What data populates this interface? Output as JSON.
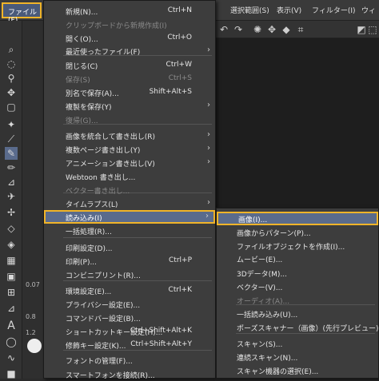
{
  "menubar": {
    "file_label": "ファイル(F)",
    "items": [
      "選択範囲(S)",
      "表示(V)",
      "フィルター(I)",
      "ウィ"
    ]
  },
  "file_menu": {
    "items": [
      {
        "label": "新規(N)...",
        "shortcut": "Ctrl+N",
        "submenu": false,
        "disabled": false
      },
      {
        "label": "クリップボードから新規作成(I)",
        "shortcut": "",
        "submenu": false,
        "disabled": true
      },
      {
        "label": "開く(O)...",
        "shortcut": "Ctrl+O",
        "submenu": false,
        "disabled": false
      },
      {
        "label": "最近使ったファイル(F)",
        "shortcut": "",
        "submenu": true,
        "disabled": false
      },
      {
        "label": "閉じる(C)",
        "shortcut": "Ctrl+W",
        "submenu": false,
        "disabled": false
      },
      {
        "label": "保存(S)",
        "shortcut": "Ctrl+S",
        "submenu": false,
        "disabled": true
      },
      {
        "label": "別名で保存(A)...",
        "shortcut": "Shift+Alt+S",
        "submenu": false,
        "disabled": false
      },
      {
        "label": "複製を保存(Y)",
        "shortcut": "",
        "submenu": true,
        "disabled": false
      },
      {
        "label": "復帰(G)...",
        "shortcut": "",
        "submenu": false,
        "disabled": true
      },
      {
        "label": "画像を統合して書き出し(R)",
        "shortcut": "",
        "submenu": true,
        "disabled": false
      },
      {
        "label": "複数ページ書き出し(Y)",
        "shortcut": "",
        "submenu": true,
        "disabled": false
      },
      {
        "label": "アニメーション書き出し(V)",
        "shortcut": "",
        "submenu": true,
        "disabled": false
      },
      {
        "label": "Webtoon 書き出し...",
        "shortcut": "",
        "submenu": false,
        "disabled": false
      },
      {
        "label": "ベクター書き出し...",
        "shortcut": "",
        "submenu": false,
        "disabled": true
      },
      {
        "label": "タイムラプス(L)",
        "shortcut": "",
        "submenu": true,
        "disabled": false
      },
      {
        "label": "読み込み(I)",
        "shortcut": "",
        "submenu": true,
        "disabled": false,
        "highlight": true
      },
      {
        "label": "一括処理(R)...",
        "shortcut": "",
        "submenu": false,
        "disabled": false
      },
      {
        "label": "印刷設定(D)...",
        "shortcut": "",
        "submenu": false,
        "disabled": false
      },
      {
        "label": "印刷(P)...",
        "shortcut": "Ctrl+P",
        "submenu": false,
        "disabled": false
      },
      {
        "label": "コンビニプリント(R)...",
        "shortcut": "",
        "submenu": false,
        "disabled": false
      },
      {
        "label": "環境設定(E)...",
        "shortcut": "Ctrl+K",
        "submenu": false,
        "disabled": false
      },
      {
        "label": "プライバシー設定(E)...",
        "shortcut": "",
        "submenu": false,
        "disabled": false
      },
      {
        "label": "コマンドバー設定(B)...",
        "shortcut": "",
        "submenu": false,
        "disabled": false
      },
      {
        "label": "ショートカットキー設定(H)...",
        "shortcut": "Ctrl+Shift+Alt+K",
        "submenu": false,
        "disabled": false
      },
      {
        "label": "修飾キー設定(K)...",
        "shortcut": "Ctrl+Shift+Alt+Y",
        "submenu": false,
        "disabled": false
      },
      {
        "label": "フォントの管理(F)...",
        "shortcut": "",
        "submenu": false,
        "disabled": false
      },
      {
        "label": "スマートフォンを接続(R)...",
        "shortcut": "",
        "submenu": false,
        "disabled": false
      }
    ]
  },
  "import_menu": {
    "items": [
      {
        "label": "画像(I)...",
        "highlight": true,
        "disabled": false
      },
      {
        "label": "画像からパターン(P)...",
        "disabled": false
      },
      {
        "label": "ファイルオブジェクトを作成(I)...",
        "disabled": false
      },
      {
        "label": "ムービー(E)...",
        "disabled": false
      },
      {
        "label": "3Dデータ(M)...",
        "disabled": false
      },
      {
        "label": "ベクター(V)...",
        "disabled": false
      },
      {
        "label": "オーディオ(A)...",
        "disabled": true
      },
      {
        "label": "一括読み込み(U)...",
        "disabled": false
      },
      {
        "label": "ポーズスキャナー（画像）(先行プレビュー)(B)...",
        "disabled": false
      },
      {
        "label": "スキャン(S)...",
        "disabled": false
      },
      {
        "label": "連続スキャン(N)...",
        "disabled": false
      },
      {
        "label": "スキャン機器の選択(E)...",
        "disabled": false
      }
    ]
  },
  "sub_panel": {
    "brush_sizes": [
      "0.07",
      "0.8",
      "1.2"
    ]
  },
  "icons": {
    "submenu_arrow": "chevron-right-icon"
  },
  "colors": {
    "highlight_bg": "#5a6b8c",
    "highlight_border": "#f0b429",
    "menu_bg": "#3d3d3d"
  }
}
